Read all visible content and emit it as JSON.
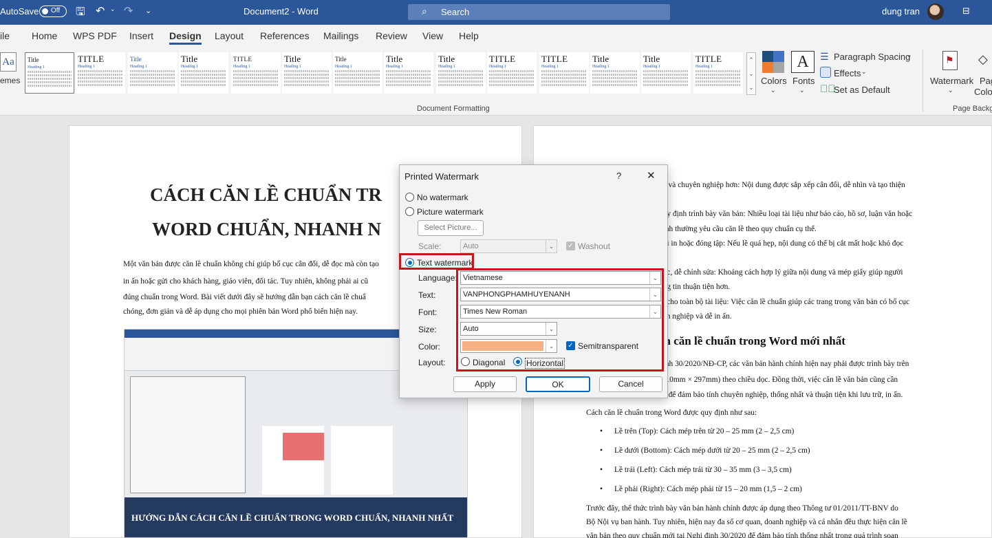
{
  "titlebar": {
    "autosave_label": "AutoSave",
    "autosave_state": "Off",
    "doc_title": "Document2  -  Word",
    "search_placeholder": "Search",
    "user_name": "dung tran"
  },
  "tabs": [
    "ile",
    "Home",
    "WPS PDF",
    "Insert",
    "Design",
    "Layout",
    "References",
    "Mailings",
    "Review",
    "View",
    "Help"
  ],
  "active_tab": "Design",
  "ribbon": {
    "themes_label": "emes",
    "style_gallery": [
      "Title",
      "TITLE",
      "Title",
      "Title",
      "TITLE",
      "Title",
      "Title",
      "Title",
      "Title",
      "TITLE",
      "TITLE",
      "Title",
      "Title",
      "TITLE"
    ],
    "heading_sample": "Heading 1",
    "colors_label": "Colors",
    "fonts_label": "Fonts",
    "paragraph_spacing": "Paragraph Spacing",
    "effects": "Effects",
    "set_as_default": "Set as Default",
    "group_document_formatting": "Document Formatting",
    "watermark_label": "Watermark",
    "page_label": "Pag",
    "page_color_label": "Colo",
    "group_page_background": "Page Backg"
  },
  "document": {
    "left_title_line1": "CÁCH CĂN LỀ CHUẨN TR",
    "left_title_line2": "WORD CHUẨN, NHANH N",
    "left_paragraph": [
      "Một văn bản được căn lề chuẩn không chỉ giúp bố cục cân đối, dễ đọc mà còn tạo",
      "in ấn hoặc gửi cho khách hàng, giáo viên, đối tác. Tuy nhiên, không phải ai cũ",
      "đúng chuẩn trong Word. Bài viết dưới đây sẽ hướng dẫn bạn cách căn lề chuẩ",
      "chóng, đơn giản và dễ áp dụng cho mọi phiên bản Word phổ biến hiện nay."
    ],
    "image_caption": "HƯỚNG DẪN CÁCH CĂN LỀ CHUẨN TRONG WORD CHUẨN, NHANH NHẤT",
    "right_lines_top": [
      "ẹp và chuyên nghiệp hơn: Nội dung được sắp xếp cân đối, dễ nhìn và tạo thiện",
      "",
      "quy định trình bày văn bản: Nhiều loại tài liệu như báo cáo, hồ sơ, luận văn hoặc",
      "hính thường yêu cầu căn lề theo quy chuẩn cụ thể.",
      "khi in hoặc đóng tập: Nếu lề quá hẹp, nội dung có thể bị cắt mất hoặc khó đọc",
      "ụy.",
      "đọc, dễ chỉnh sửa: Khoảng cách hợp lý giữa nội dung và mép giấy giúp người",
      "ông tin thuận tiện hơn.",
      "ất cho toàn bộ tài liệu: Việc căn lề chuẩn giúp các trang trong văn bản có bố cục",
      "yên nghiệp và dễ in ấn."
    ],
    "right_heading": "ch căn lề chuẩn trong Word mới nhất",
    "right_lines_mid": [
      "định 30/2020/NĐ-CP, các văn bản hành chính hiện nay phải được trình bày trên",
      "(210mm × 297mm) theo chiều dọc. Đồng thời, việc căn lề văn bản cũng cần",
      "ản để đảm bảo tính chuyên nghiệp, thống nhất và thuận tiện khi lưu trữ, in ấn."
    ],
    "rules_intro": "Cách căn lề chuẩn trong Word được quy định như sau:",
    "bullets": [
      "Lề trên (Top): Cách mép trên từ 20 – 25 mm (2 – 2,5 cm)",
      "Lề dưới (Bottom): Cách mép dưới từ 20 – 25 mm (2 – 2,5 cm)",
      "Lề trái (Left): Cách mép trái từ 30 – 35 mm (3 – 3,5 cm)",
      "Lề phải (Right): Cách mép phải từ 15 – 20 mm (1,5 – 2 cm)"
    ],
    "right_lines_bottom": [
      "Trước đây, thể thức trình bày văn bản hành chính được áp dụng theo Thông tư 01/2011/TT-BNV do",
      "Bộ Nội vụ ban hành. Tuy nhiên, hiện nay đa số cơ quan, doanh nghiệp và cá nhân đều thực hiện căn lề",
      "văn bản theo quy chuẩn mới tại Nghị định 30/2020 để đảm bảo tính thống nhất trong quá trình soạn"
    ]
  },
  "dialog": {
    "title": "Printed Watermark",
    "help": "?",
    "close": "✕",
    "no_watermark": "No watermark",
    "picture_watermark": "Picture watermark",
    "select_picture": "Select Picture...",
    "scale_label": "Scale:",
    "scale_value": "Auto",
    "washout": "Washout",
    "text_watermark": "Text watermark",
    "language_label": "Language:",
    "language_value": "Vietnamese",
    "text_label": "Text:",
    "text_value": "VANPHONGPHAMHUYENANH",
    "font_label": "Font:",
    "font_value": "Times New Roman",
    "size_label": "Size:",
    "size_value": "Auto",
    "color_label": "Color:",
    "color_value": "#f4b183",
    "semitransparent": "Semitransparent",
    "layout_label": "Layout:",
    "diagonal": "Diagonal",
    "horizontal": "Horizontal",
    "apply": "Apply",
    "ok": "OK",
    "cancel": "Cancel"
  },
  "colors": {
    "accent": "#2b579a",
    "highlight": "#c4161c",
    "watermark_color": "#f4b183"
  }
}
